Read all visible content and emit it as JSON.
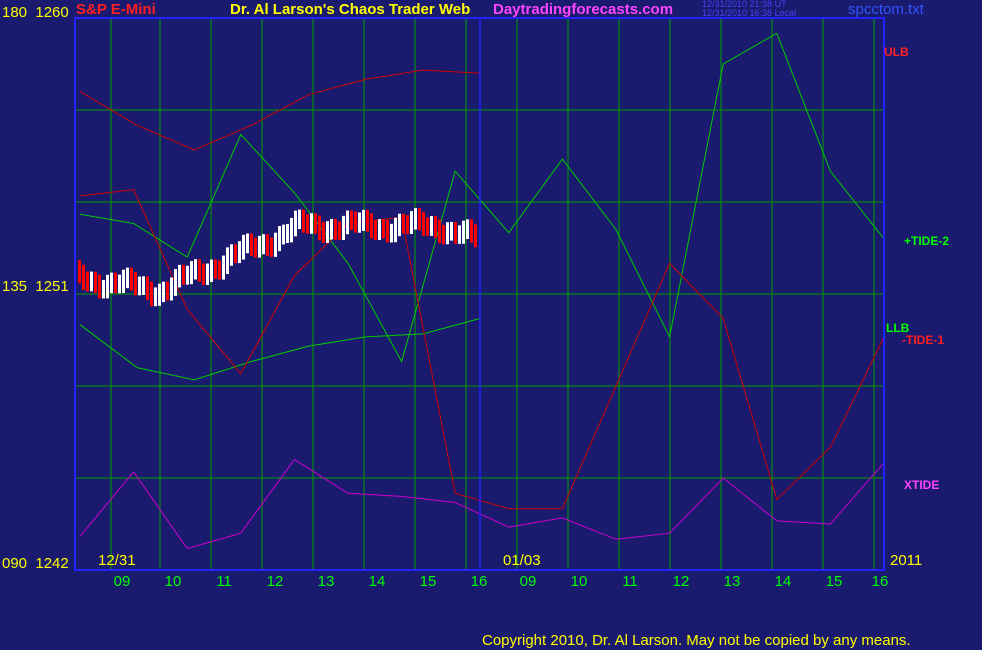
{
  "header": {
    "symbol": "S&P E-Mini",
    "title": "Dr. Al Larson's Chaos Trader Web",
    "site": "Daytradingforecasts.com",
    "timestamp_ut": "12/31/2010 21:38 UT",
    "timestamp_local": "12/31/2010 16:38 Local",
    "file": "spcctom.txt"
  },
  "y_axis": {
    "top": {
      "deg": "180",
      "price": "1260"
    },
    "mid": {
      "deg": "135",
      "price": "1251"
    },
    "bottom": {
      "deg": "090",
      "price": "1242"
    }
  },
  "date_labels": {
    "left": "12/31",
    "mid": "01/03",
    "right": "2011"
  },
  "series_labels": {
    "ulb": "ULB",
    "tide2": "+TIDE-2",
    "llb": "LLB",
    "tide1": "-TIDE-1",
    "xtide": "XTIDE"
  },
  "copyright": "Copyright 2010, Dr. Al Larson. May not be copied by any means.",
  "colors": {
    "background": "#1a1a6e",
    "grid": "#00a000",
    "axis": "#2222ff",
    "ulb": "#cc0000",
    "tide": "#00cc00",
    "xtide": "#cc00cc",
    "bars_up": "#ffffff",
    "bars_down": "#ff0000",
    "blue_ma": "#2222ff"
  },
  "chart_data": {
    "type": "line",
    "title": "S&P E-Mini",
    "ylim": [
      1242,
      1260
    ],
    "x_ticks": [
      "09",
      "10",
      "11",
      "12",
      "13",
      "14",
      "15",
      "16",
      "09",
      "10",
      "11",
      "12",
      "13",
      "14",
      "15",
      "16"
    ],
    "sessions": [
      "12/31",
      "01/03"
    ],
    "series": [
      {
        "name": "ULB",
        "values": [
          1257.6,
          1256.5,
          1255.7,
          1256.5,
          1257.5,
          1258.0,
          1258.3,
          1258.2
        ]
      },
      {
        "name": "LLB",
        "values": [
          1250.0,
          1248.6,
          1248.2,
          1248.8,
          1249.3,
          1249.6,
          1249.7,
          1250.2
        ]
      },
      {
        "name": "+TIDE-2",
        "values": [
          1253.6,
          1253.3,
          1252.2,
          1256.2,
          1254.3,
          1252.0,
          1248.8,
          1255.0,
          1253.0,
          1255.4,
          1253.1,
          1249.6,
          1258.5,
          1259.5,
          1255.0,
          1252.8
        ]
      },
      {
        "name": "-TIDE-1",
        "values": [
          1254.2,
          1254.4,
          1250.5,
          1248.4,
          1251.6,
          1253.3,
          1253.5,
          1244.5,
          1244.0,
          1244.0,
          1248.0,
          1252.0,
          1250.2,
          1244.3,
          1246.0,
          1249.6
        ]
      },
      {
        "name": "XTIDE",
        "values": [
          1243.1,
          1245.2,
          1242.7,
          1243.2,
          1245.6,
          1244.5,
          1244.4,
          1244.2,
          1243.4,
          1243.7,
          1243.0,
          1243.2,
          1245.0,
          1243.6,
          1243.5,
          1245.5
        ]
      }
    ]
  }
}
